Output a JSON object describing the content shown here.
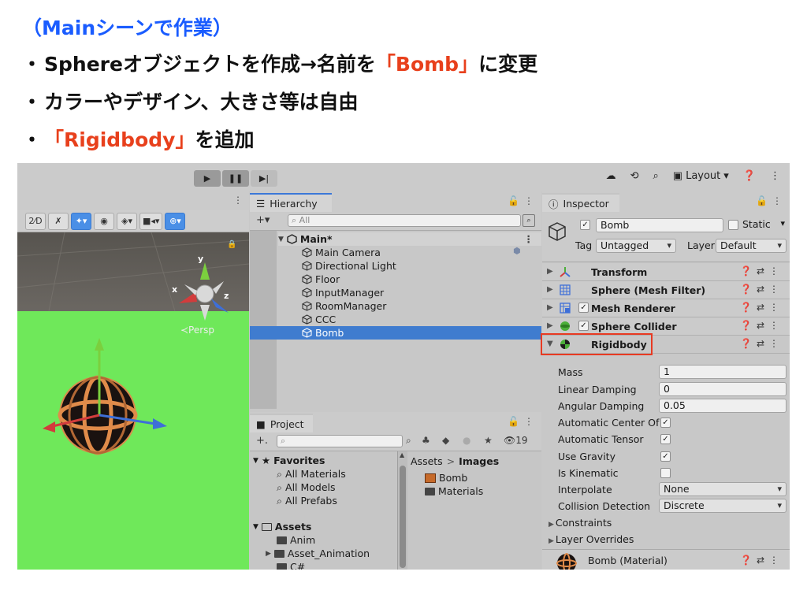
{
  "slide": {
    "title": "（Mainシーンで作業）",
    "bullets": [
      {
        "dot": "・",
        "pre": "Sphereオブジェクトを作成→名前を",
        "hl": "「Bomb」",
        "post": "に変更"
      },
      {
        "dot": "・",
        "pre": "カラーやデザイン、大きさ等は自由",
        "hl": "",
        "post": ""
      },
      {
        "dot": "・",
        "pre": "",
        "hl": "「Rigidbody」",
        "post": "を追加"
      }
    ]
  },
  "toolbar": {
    "layout_label": "Layout",
    "icons": [
      "cloud-icon",
      "history-icon",
      "search-icon",
      "layout-icon",
      "help-icon",
      "more-icon"
    ]
  },
  "scene": {
    "persp_label": "≺Persp",
    "gizmo_axes": {
      "x": "x",
      "y": "y",
      "z": "z"
    },
    "tools": [
      "2D",
      "light-off",
      "audio",
      "effects",
      "visibility",
      "layers",
      "camera",
      "gizmos"
    ]
  },
  "hierarchy": {
    "tab_label": "Hierarchy",
    "search_placeholder": "All",
    "scene_name": "Main*",
    "items": [
      "Main Camera",
      "Directional Light",
      "Floor",
      "InputManager",
      "RoomManager",
      "CCC",
      "Bomb"
    ],
    "selected": "Bomb"
  },
  "project": {
    "tab_label": "Project",
    "count": "19",
    "favorites_label": "Favorites",
    "favorites": [
      "All Materials",
      "All Models",
      "All Prefabs"
    ],
    "assets_label": "Assets",
    "assets": [
      "Anim",
      "Asset_Animation",
      "C#"
    ],
    "breadcrumb_root": "Assets",
    "breadcrumb_sep": ">",
    "breadcrumb_current": "Images",
    "files": [
      "Bomb",
      "Materials"
    ]
  },
  "inspector": {
    "tab_label": "Inspector",
    "object_name": "Bomb",
    "static_label": "Static",
    "tag_label": "Tag",
    "tag_value": "Untagged",
    "layer_label": "Layer",
    "layer_value": "Default",
    "components": [
      {
        "name": "Transform",
        "checkbox": false
      },
      {
        "name": "Sphere (Mesh Filter)",
        "checkbox": false
      },
      {
        "name": "Mesh Renderer",
        "checkbox": true
      },
      {
        "name": "Sphere Collider",
        "checkbox": true
      },
      {
        "name": "Rigidbody",
        "checkbox": false
      }
    ],
    "rigidbody": {
      "mass_label": "Mass",
      "mass": "1",
      "linear_damping_label": "Linear Damping",
      "linear_damping": "0",
      "angular_damping_label": "Angular Damping",
      "angular_damping": "0.05",
      "auto_center_label": "Automatic Center Of",
      "auto_tensor_label": "Automatic Tensor",
      "use_gravity_label": "Use Gravity",
      "is_kinematic_label": "Is Kinematic",
      "interpolate_label": "Interpolate",
      "interpolate": "None",
      "collision_label": "Collision Detection",
      "collision": "Discrete",
      "constraints_label": "Constraints",
      "layer_overrides_label": "Layer Overrides"
    },
    "material_label": "Bomb (Material)"
  },
  "colors": {
    "accent_blue": "#1a5cff",
    "highlight_red": "#e8401c",
    "selection": "#3f7ccf",
    "ground": "#6fe85a"
  }
}
